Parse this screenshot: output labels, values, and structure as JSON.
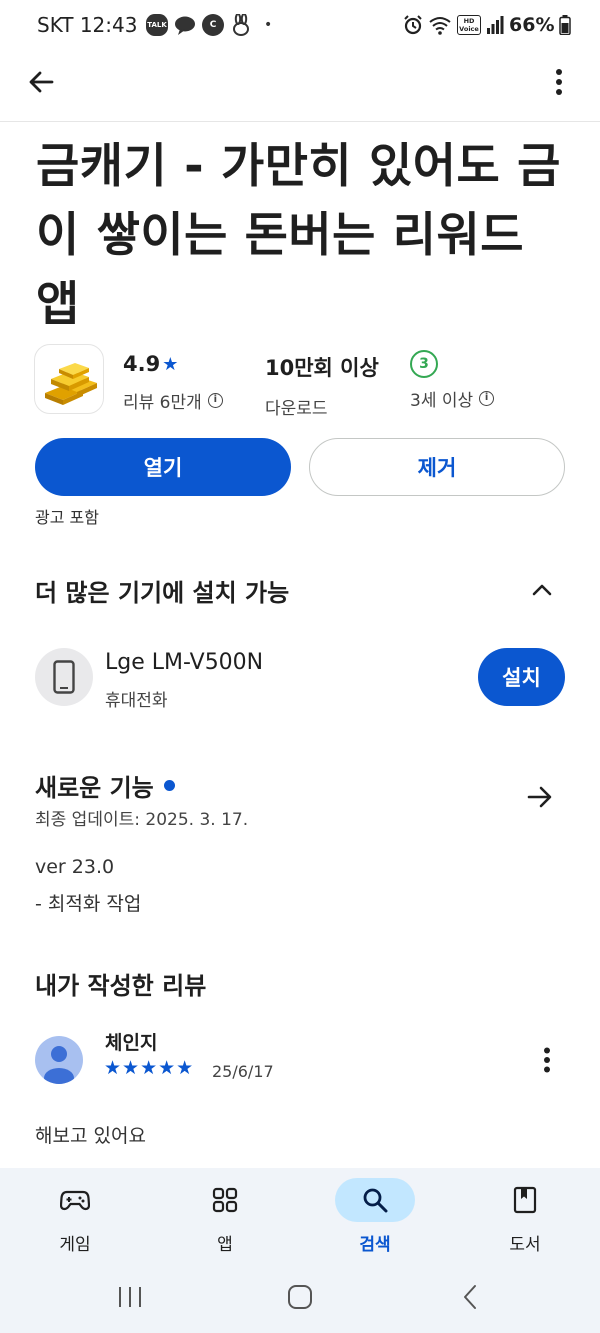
{
  "status_bar": {
    "carrier_time": "SKT 12:43",
    "notif_icons": [
      "talk-icon",
      "chat-bubble-icon",
      "c-icon",
      "rabbit-icon"
    ],
    "dot": "•",
    "battery": "66%",
    "network_badge": "HD Voice",
    "talk_label": "TALK",
    "c_label": "C"
  },
  "app": {
    "title": "금캐기 - 가만히 있어도 금이 쌓이는 돈버는 리워드 앱",
    "rating": "4.9",
    "rating_star": "★",
    "reviews_label": "리뷰 6만개",
    "downloads": "10만회 이상",
    "downloads_label": "다운로드",
    "age_badge": "3",
    "age_label": "3세 이상",
    "open_button": "열기",
    "remove_button": "제거",
    "ads_label": "광고 포함"
  },
  "devices_section": {
    "title": "더 많은 기기에 설치 가능",
    "device_name": "Lge LM-V500N",
    "device_type": "휴대전화",
    "install_button": "설치"
  },
  "whats_new": {
    "title": "새로운 기능",
    "last_updated": "최종 업데이트: 2025. 3. 17.",
    "version": "ver 23.0",
    "notes": "- 최적화 작업"
  },
  "my_review": {
    "section_title": "내가 작성한 리뷰",
    "reviewer": "체인지",
    "stars": "★★★★★",
    "rating_value": 5,
    "date": "25/6/17",
    "text": "해보고 있어요"
  },
  "bottom_nav": {
    "items": [
      {
        "label": "게임",
        "icon": "gamepad-icon",
        "active": false
      },
      {
        "label": "앱",
        "icon": "apps-grid-icon",
        "active": false
      },
      {
        "label": "검색",
        "icon": "search-icon",
        "active": true
      },
      {
        "label": "도서",
        "icon": "book-icon",
        "active": false
      }
    ]
  },
  "colors": {
    "primary": "#0b57d0",
    "nav_background": "#f0f4f9",
    "nav_active_pill": "#c2e7ff",
    "age_badge_green": "#34a853"
  }
}
